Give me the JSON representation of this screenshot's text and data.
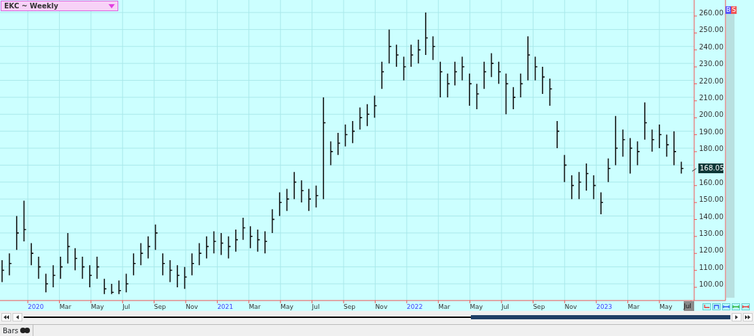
{
  "chart": {
    "title": "EKC ~ Weekly",
    "last_price": "168.05",
    "buttons": [
      "B",
      "S"
    ],
    "price_axis": {
      "upper": [
        "260.00",
        "250.00",
        "240.00",
        "230.00",
        "220.00",
        "210.00",
        "200.00",
        "190.00",
        "180.00"
      ],
      "lower": [
        "160.00",
        "150.00",
        "140.00",
        "130.00",
        "120.00",
        "110.00",
        "100.00"
      ]
    },
    "date_axis": [
      {
        "label": "2020",
        "kind": "year"
      },
      {
        "label": "Mar",
        "kind": "month"
      },
      {
        "label": "May",
        "kind": "month"
      },
      {
        "label": "Jul",
        "kind": "month"
      },
      {
        "label": "Sep",
        "kind": "month"
      },
      {
        "label": "Nov",
        "kind": "month"
      },
      {
        "label": "2021",
        "kind": "year"
      },
      {
        "label": "Mar",
        "kind": "month"
      },
      {
        "label": "May",
        "kind": "month"
      },
      {
        "label": "Jul",
        "kind": "month"
      },
      {
        "label": "Sep",
        "kind": "month"
      },
      {
        "label": "Nov",
        "kind": "month"
      },
      {
        "label": "2022",
        "kind": "year"
      },
      {
        "label": "Mar",
        "kind": "month"
      },
      {
        "label": "May",
        "kind": "month"
      },
      {
        "label": "Jul",
        "kind": "month"
      },
      {
        "label": "Sep",
        "kind": "month"
      },
      {
        "label": "Nov",
        "kind": "month"
      },
      {
        "label": "2023",
        "kind": "year"
      },
      {
        "label": "Mar",
        "kind": "month"
      },
      {
        "label": "May",
        "kind": "month"
      },
      {
        "label": "Jul",
        "kind": "cursor"
      }
    ]
  },
  "status_bar": {
    "tab": "Bars"
  }
}
